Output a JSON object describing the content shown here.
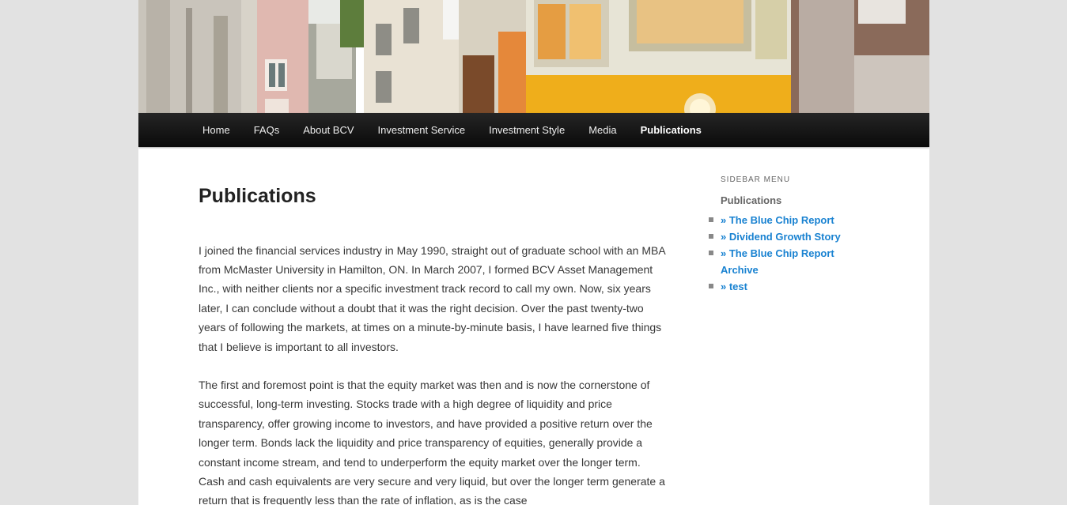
{
  "nav": {
    "items": [
      {
        "label": "Home"
      },
      {
        "label": "FAQs"
      },
      {
        "label": "About BCV"
      },
      {
        "label": "Investment Service"
      },
      {
        "label": "Investment Style"
      },
      {
        "label": "Media"
      },
      {
        "label": "Publications"
      }
    ],
    "current": "Publications"
  },
  "main": {
    "title": "Publications",
    "paragraphs": [
      "I joined the financial services industry in May 1990, straight out of graduate school with an MBA from McMaster University in Hamilton, ON. In March 2007, I formed BCV Asset Management Inc., with neither clients nor a specific investment track record to call my own. Now, six years later, I can conclude without a doubt that it was the right decision. Over the past twenty-two years of following the markets, at times on a minute-by-minute basis, I have learned five things that I believe is important to all investors.",
      "The first and foremost point is that the equity market was then and is now the cornerstone of successful, long-term investing. Stocks trade with a high degree of liquidity and price transparency, offer growing income to investors, and have provided a positive return over the longer term. Bonds lack the liquidity and price transparency of equities, generally provide a constant income stream, and tend to underperform the equity market over the longer term. Cash and cash equivalents are very secure and very liquid, but over the longer term generate a return that is frequently less than the rate of inflation, as is the case"
    ]
  },
  "sidebar": {
    "widget_title": "Sidebar Menu",
    "heading": "Publications",
    "items": [
      {
        "label": "» The Blue Chip Report"
      },
      {
        "label": "» Dividend Growth Story"
      },
      {
        "label": "» The Blue Chip Report Archive"
      },
      {
        "label": "» test"
      }
    ]
  },
  "colors": {
    "link": "#1982d1",
    "nav_bg": "#111111",
    "page_bg": "#e2e2e2"
  }
}
